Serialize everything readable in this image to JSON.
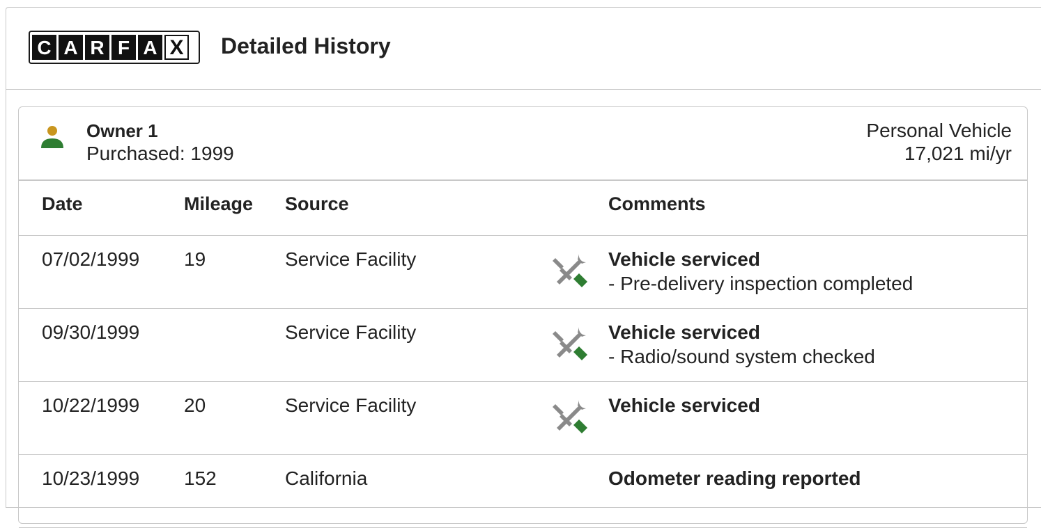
{
  "header": {
    "logo_letters": [
      "C",
      "A",
      "R",
      "F",
      "A",
      "X"
    ],
    "title": "Detailed History"
  },
  "owner": {
    "name": "Owner 1",
    "purchased": "Purchased: 1999",
    "type": "Personal Vehicle",
    "mileage_rate": "17,021 mi/yr",
    "icon": "person-icon"
  },
  "table": {
    "headers": {
      "date": "Date",
      "mileage": "Mileage",
      "source": "Source",
      "comments": "Comments"
    },
    "rows": [
      {
        "date": "07/02/1999",
        "mileage": "19",
        "source": "Service Facility",
        "icon": "service-wrench-icon",
        "comment_title": "Vehicle serviced",
        "comment_detail": "- Pre-delivery inspection completed"
      },
      {
        "date": "09/30/1999",
        "mileage": "",
        "source": "Service Facility",
        "icon": "service-wrench-icon",
        "comment_title": "Vehicle serviced",
        "comment_detail": "- Radio/sound system checked"
      },
      {
        "date": "10/22/1999",
        "mileage": "20",
        "source": "Service Facility",
        "icon": "service-wrench-icon",
        "comment_title": "Vehicle serviced",
        "comment_detail": ""
      },
      {
        "date": "10/23/1999",
        "mileage": "152",
        "source": "California",
        "icon": "",
        "comment_title": "Odometer reading reported",
        "comment_detail": ""
      }
    ]
  },
  "colors": {
    "owner_head": "#c9961f",
    "owner_body": "#2e7d32",
    "tool_gray": "#8a8a8a",
    "tool_green": "#2e7d32",
    "border": "#c8c8c8"
  }
}
